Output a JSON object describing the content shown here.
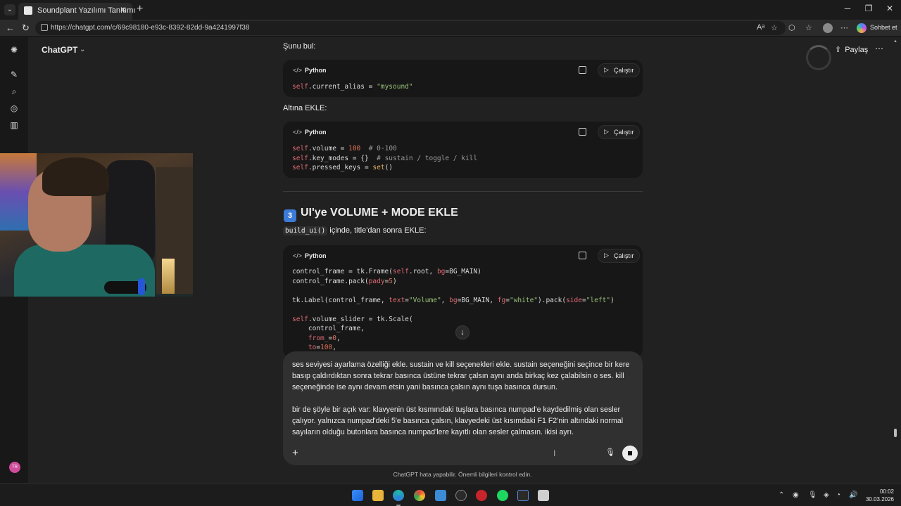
{
  "browser": {
    "tab_title": "Soundplant Yazılımı Tanıtımı",
    "url": "https://chatgpt.com/c/69c98180-e93c-8392-82dd-9a4241997f38",
    "copilot_label": "Sohbet et"
  },
  "app": {
    "title": "ChatGPT",
    "share_label": "Paylaş"
  },
  "conversation": {
    "para1": "Şunu bul:",
    "block1": {
      "lang": "Python",
      "run_label": "Çalıştır"
    },
    "para2": "Altına EKLE:",
    "block2": {
      "lang": "Python",
      "run_label": "Çalıştır"
    },
    "section_number": "3",
    "section_heading": "UI'ye VOLUME + MODE EKLE",
    "inline_code": "build_ui()",
    "para3_rest": " içinde, title'dan sonra EKLE:",
    "block3": {
      "lang": "Python",
      "run_label": "Çalıştır"
    }
  },
  "composer": {
    "paragraph1": "ses seviyesi ayarlama özelliği ekle. sustain ve kill seçenekleri ekle. sustain seçeneğini seçince bir kere basıp çaldırdıktan sonra tekrar basınca üstüne tekrar çalsın aynı anda birkaç kez çalabilsin o ses. kill seçeneğinde ise aynı devam etsin yani basınca çalsın aynı tuşa basınca dursun.",
    "paragraph2": "bir de şöyle bir açık var: klavyenin üst kısmındaki  tuşlara basınca numpad'e kaydedilmiş olan sesler çalıyor. yalnızca numpad'deki 5'e basınca çalsın, klavyedeki üst kısımdaki F1 F2'nin altındaki normal sayıların olduğu butonlara basınca numpad'lere kayıtlı olan sesler çalmasın. ikisi ayrı."
  },
  "footer_note": "ChatGPT hata yapabilir. Önemli bilgileri kontrol edin.",
  "user_initials": "TR",
  "taskbar": {
    "time": "00:02",
    "date": "30.03.2026"
  },
  "colors": {
    "background": "#212121",
    "code_bg": "#171717",
    "composer_bg": "#303030",
    "string": "#98c379",
    "self": "#e06c75",
    "number": "#e0735a"
  }
}
